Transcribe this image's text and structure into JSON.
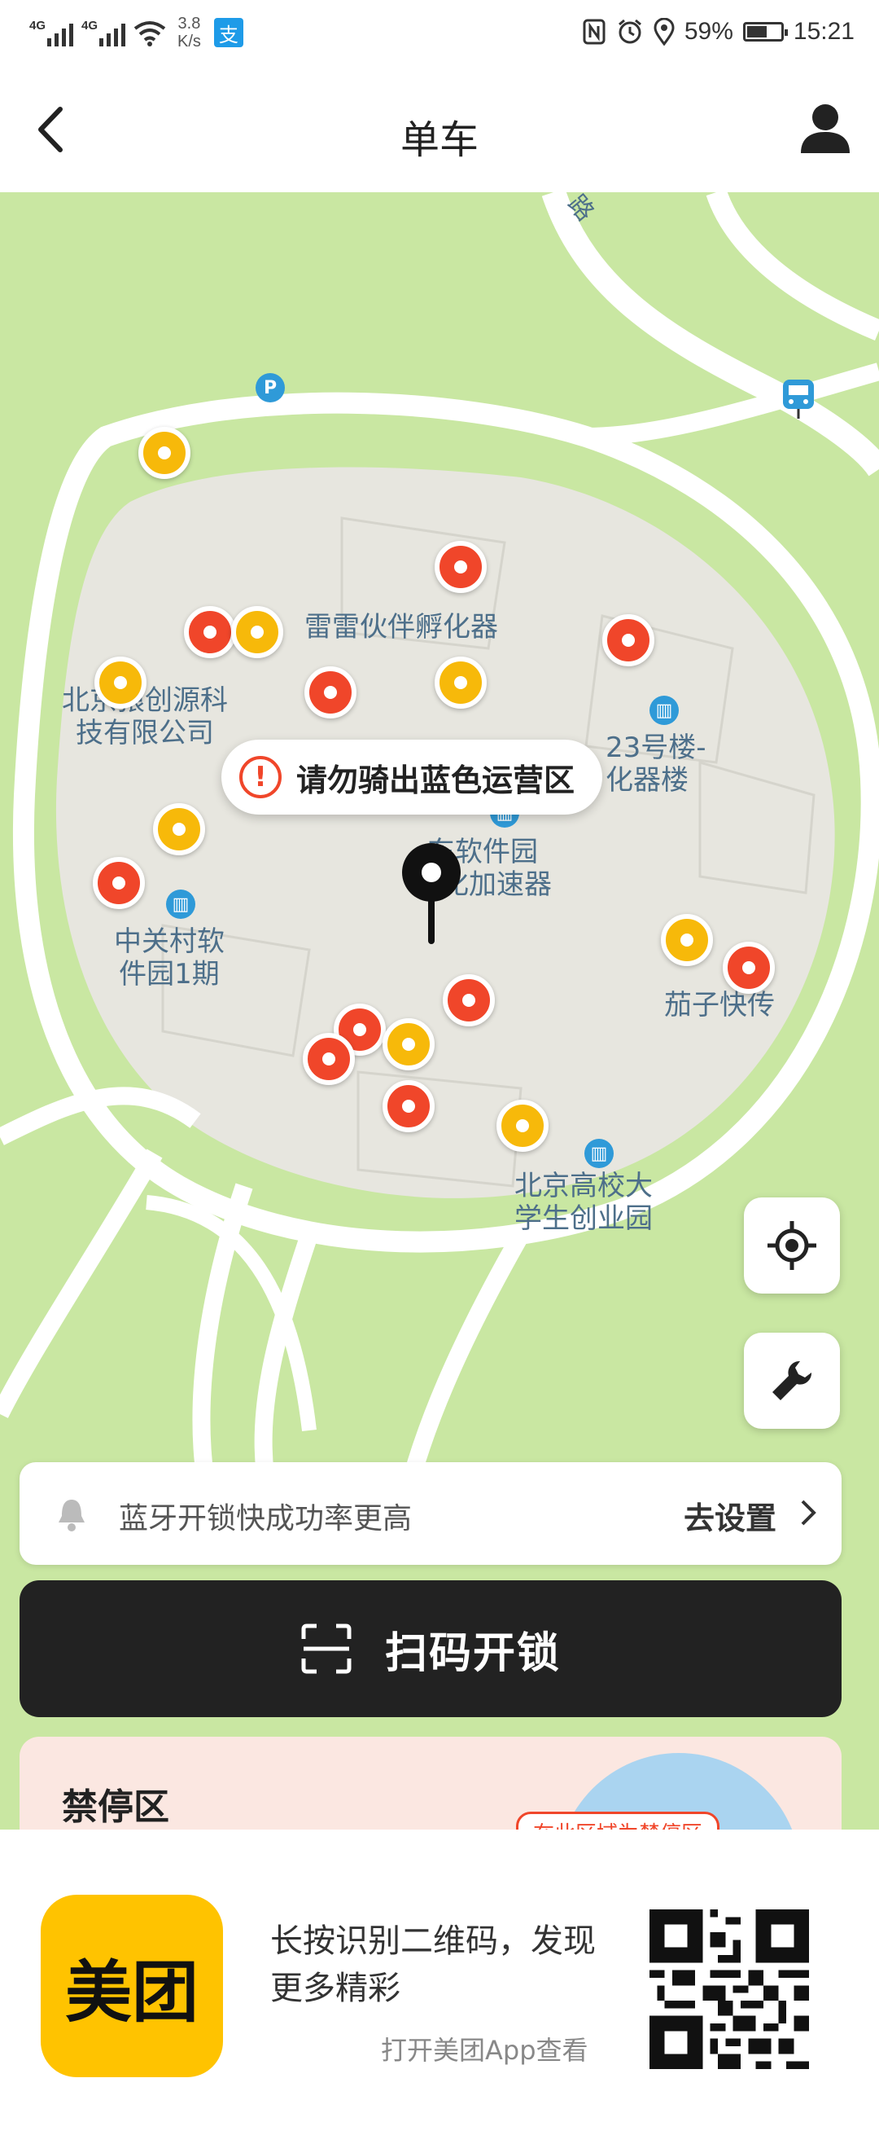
{
  "status_bar": {
    "network1": "4G",
    "network2": "4G",
    "speed_value": "3.8",
    "speed_unit": "K/s",
    "battery": "59%",
    "battery_level": 0.59,
    "time": "15:21"
  },
  "header": {
    "title": "单车"
  },
  "map": {
    "labels": {
      "incubator": "雷雷伙伴孵化器",
      "yuanchuang": "北京猿创源科\n技有限公司",
      "building23": "23号楼-\n化器楼",
      "software_park": "东软件园\n孵化加速器",
      "zgc": "中关村软\n件园1期",
      "qiezi": "茄子快传",
      "bj_univ": "北京高校大\n学生创业园",
      "road": "路"
    },
    "parking_symbol": "P",
    "warning": "请勿骑出蓝色运营区"
  },
  "bluetooth": {
    "text": "蓝牙开锁快成功率更高",
    "action": "去设置"
  },
  "scan": {
    "label": "扫码开锁"
  },
  "no_parking": {
    "title": "禁停区",
    "tag": "在此区域为禁停区"
  },
  "promo": {
    "logo": "美团",
    "text": "长按识别二维码，发现更多精彩",
    "sub": "打开美团App查看"
  },
  "colors": {
    "bike_red": "#f0462a",
    "bike_yellow": "#f7b90a",
    "scan_button": "#222222",
    "brand": "#ffc300"
  }
}
